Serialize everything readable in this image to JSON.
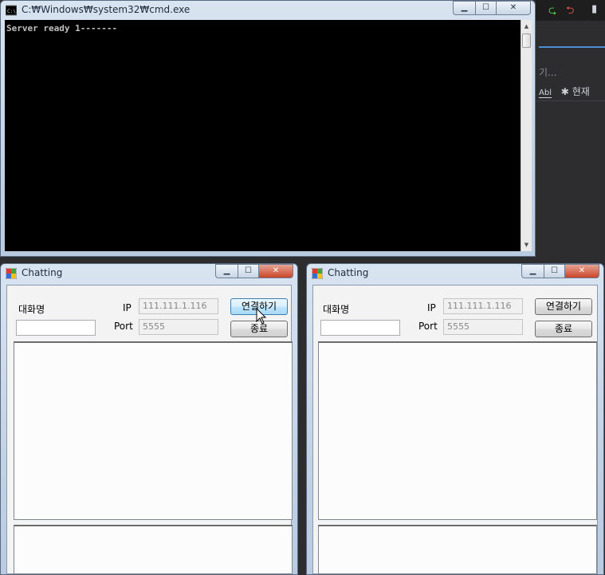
{
  "ide": {
    "search_text": "기...",
    "tool_label": "현재",
    "tool_abbr": "Abl"
  },
  "cmd": {
    "title": "C:₩Windows₩system32₩cmd.exe",
    "output": "Server ready 1-------"
  },
  "chat_windows": [
    {
      "title": "Chatting",
      "nickname_label": "대화명",
      "nickname_value": "",
      "ip_label": "IP",
      "ip_value": "111.111.1.116",
      "port_label": "Port",
      "port_value": "5555",
      "connect_label": "연결하기",
      "exit_label": "종료",
      "connect_hovered": true
    },
    {
      "title": "Chatting",
      "nickname_label": "대화명",
      "nickname_value": "",
      "ip_label": "IP",
      "ip_value": "111.111.1.116",
      "port_label": "Port",
      "port_value": "5555",
      "connect_label": "연결하기",
      "exit_label": "종료",
      "connect_hovered": false
    }
  ],
  "colors": {
    "console_bg": "#000000",
    "console_text": "#c0c0c0",
    "close_button_active": "#c9452a"
  }
}
